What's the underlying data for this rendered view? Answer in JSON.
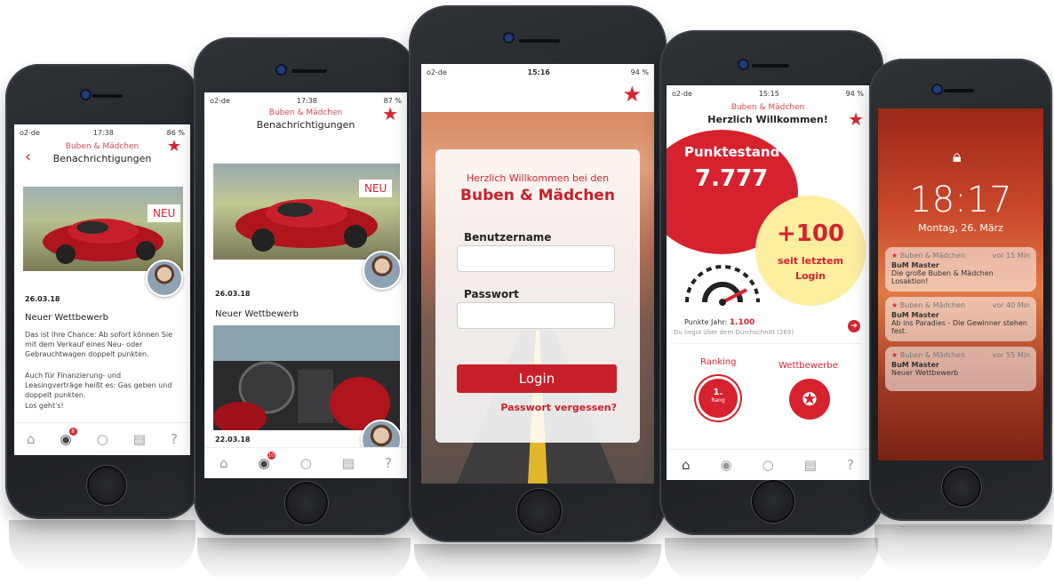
{
  "colors": {
    "brand_red": "#d42630",
    "score_red": "#d6222e",
    "yellow": "#fdeea0"
  },
  "phone1": {
    "status": {
      "carrier": "o2-de",
      "time": "17:38",
      "battery": "86 %"
    },
    "brand": "Buben & Mädchen",
    "title": "Benachrichtigungen",
    "neu": "NEU",
    "date": "26.03.18",
    "heading": "Neuer Wettbewerb",
    "body1": "Das ist Ihre Chance: Ab sofort können Sie mit dem Verkauf eines Neu- oder Gebrauchtwagen doppelt punkten.",
    "body2": "Auch für Finanzierung- und Leasingverträge heißt es: Gas geben und doppelt punkten.",
    "body3": "Los geht's!",
    "tab_badge": "8"
  },
  "phone2": {
    "status": {
      "carrier": "o2-de",
      "time": "17:38",
      "battery": "87 %"
    },
    "brand": "Buben & Mädchen",
    "title": "Benachrichtigungen",
    "neu": "NEU",
    "date1": "26.03.18",
    "heading": "Neuer Wettbewerb",
    "date2": "22.03.18",
    "tab_badge": "10"
  },
  "phone3": {
    "status": {
      "carrier": "o2-de",
      "time": "15:16",
      "battery": "94 %"
    },
    "welcome": "Herzlich Willkommen bei den",
    "brand": "Buben & Mädchen",
    "username_label": "Benutzername",
    "password_label": "Passwort",
    "login_button": "Login",
    "forgot": "Passwort vergessen?"
  },
  "phone4": {
    "status": {
      "carrier": "o2-de",
      "time": "15:15",
      "battery": "94 %"
    },
    "brand": "Buben & Mädchen",
    "title": "Herzlich Willkommen!",
    "score_label": "Punktestand",
    "score_value": "7.777",
    "plus_value": "+100",
    "plus_caption": "seit letztem Login",
    "year_label": "Punkte Jahr:",
    "year_value": "1.100",
    "avg_text": "Du liegst über dem Durchschnitt (269)",
    "ranking_label": "Ranking",
    "rank_value": "1.",
    "rank_sub": "Rang",
    "contests_label": "Wettbewerbe"
  },
  "phone5": {
    "time": "18:17",
    "date": "Montag, 26. März",
    "notifications": [
      {
        "app": "Buben & Mädchen",
        "ago": "vor 15 Min",
        "sender": "BuM Master",
        "text": "Die große Buben & Mädchen Losaktion!"
      },
      {
        "app": "Buben & Mädchen",
        "ago": "vor 40 Min",
        "sender": "BuM Master",
        "text": "Ab ins Paradies - Die Gewinner stehen fest."
      },
      {
        "app": "Buben & Mädchen",
        "ago": "vor 55 Min",
        "sender": "BuM Master",
        "text": "Neuer Wettbewerb"
      }
    ]
  }
}
